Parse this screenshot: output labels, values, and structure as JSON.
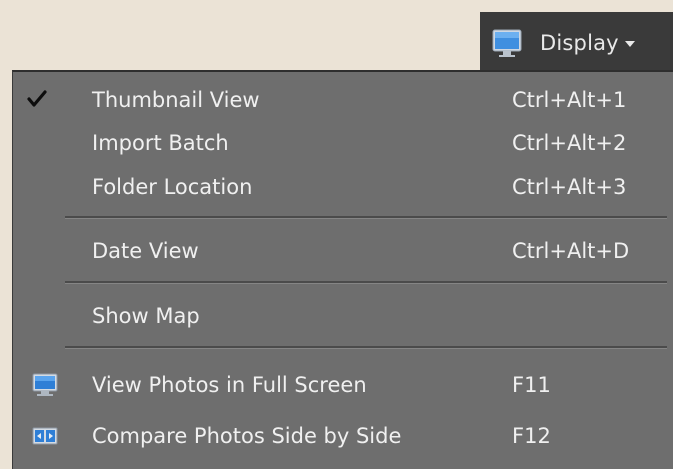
{
  "display_button": {
    "label": "Display",
    "icon": "monitor-icon"
  },
  "menu": {
    "items": [
      {
        "label": "Thumbnail View",
        "shortcut": "Ctrl+Alt+1",
        "checked": true
      },
      {
        "label": "Import Batch",
        "shortcut": "Ctrl+Alt+2",
        "checked": false
      },
      {
        "label": "Folder Location",
        "shortcut": "Ctrl+Alt+3",
        "checked": false
      },
      {
        "label": "Date View",
        "shortcut": "Ctrl+Alt+D",
        "checked": false
      },
      {
        "label": "Show Map",
        "shortcut": "",
        "checked": false
      },
      {
        "label": "View Photos in Full Screen",
        "shortcut": "F11",
        "icon": "full-screen-monitor-icon"
      },
      {
        "label": "Compare Photos Side by Side",
        "shortcut": "F12",
        "icon": "compare-side-by-side-icon"
      }
    ]
  },
  "colors": {
    "background": "#ebe3d6",
    "menu_background": "#6e6e6e",
    "button_background": "#3a3a3a",
    "text": "#f0f0f0",
    "icon_blue": "#3d8ad8"
  }
}
